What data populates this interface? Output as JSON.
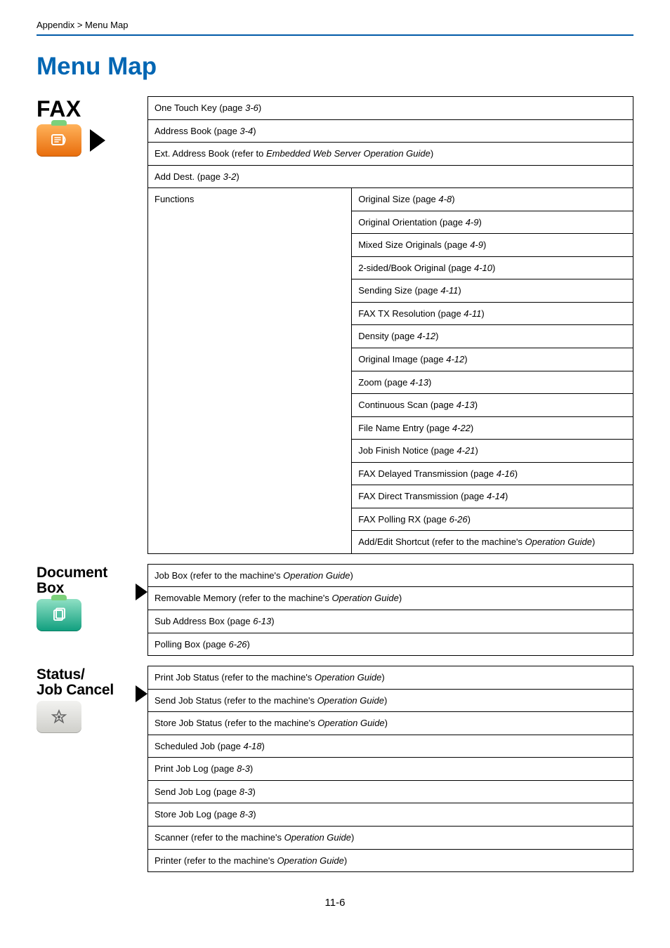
{
  "header": {
    "breadcrumb_left": "Appendix",
    "breadcrumb_sep": " > ",
    "breadcrumb_right": "Menu Map",
    "title": "Menu Map"
  },
  "sections": {
    "fax": {
      "label": "FAX",
      "rows": {
        "one_touch_key": {
          "text": "One Touch Key (page ",
          "page": "3-6",
          "close": ")"
        },
        "address_book": {
          "text": "Address Book (page ",
          "page": "3-4",
          "close": ")"
        },
        "ext_address_book": {
          "text": "Ext. Address Book (refer to ",
          "ref": "Embedded Web Server Operation Guide",
          "close": ")"
        },
        "add_dest": {
          "text": "Add Dest. (page ",
          "page": "3-2",
          "close": ")"
        },
        "functions_label": "Functions"
      },
      "functions": {
        "original_size": {
          "text": "Original Size (page ",
          "page": "4-8",
          "close": ")"
        },
        "original_orientation": {
          "text": "Original Orientation (page ",
          "page": "4-9",
          "close": ")"
        },
        "mixed_size_originals": {
          "text": "Mixed Size Originals (page ",
          "page": "4-9",
          "close": ")"
        },
        "two_sided_book": {
          "text": "2-sided/Book Original (page ",
          "page": "4-10",
          "close": ")"
        },
        "sending_size": {
          "text": "Sending Size (page ",
          "page": "4-11",
          "close": ")"
        },
        "fax_tx_resolution": {
          "text": "FAX TX Resolution (page ",
          "page": "4-11",
          "close": ")"
        },
        "density": {
          "text": "Density (page ",
          "page": "4-12",
          "close": ")"
        },
        "original_image": {
          "text": "Original Image (page ",
          "page": "4-12",
          "close": ")"
        },
        "zoom": {
          "text": "Zoom (page ",
          "page": "4-13",
          "close": ")"
        },
        "continuous_scan": {
          "text": "Continuous Scan (page ",
          "page": "4-13",
          "close": ")"
        },
        "file_name_entry": {
          "text": "File Name Entry (page ",
          "page": "4-22",
          "close": ")"
        },
        "job_finish_notice": {
          "text": "Job Finish Notice (page ",
          "page": "4-21",
          "close": ")"
        },
        "fax_delayed_tx": {
          "text": "FAX Delayed Transmission (page ",
          "page": "4-16",
          "close": ")"
        },
        "fax_direct_tx": {
          "text": "FAX Direct Transmission (page ",
          "page": "4-14",
          "close": ")"
        },
        "fax_polling_rx": {
          "text": "FAX Polling RX (page ",
          "page": "6-26",
          "close": ")"
        },
        "add_edit_shortcut": {
          "text": "Add/Edit Shortcut (refer to the machine's ",
          "ref": "Operation Guide",
          "close": ")"
        }
      }
    },
    "document_box": {
      "label_line1": "Document",
      "label_line2": "Box",
      "rows": {
        "job_box": {
          "text": "Job Box (refer to the machine's ",
          "ref": "Operation Guide",
          "close": ")"
        },
        "removable_memory": {
          "text": "Removable Memory (refer to the machine's ",
          "ref": "Operation Guide",
          "close": ")"
        },
        "sub_address_box": {
          "text": "Sub Address Box (page ",
          "page": "6-13",
          "close": ")"
        },
        "polling_box": {
          "text": "Polling Box (page ",
          "page": "6-26",
          "close": ")"
        }
      }
    },
    "status_job_cancel": {
      "label_line1": "Status/",
      "label_line2": "Job Cancel",
      "rows": {
        "print_job_status": {
          "text": "Print Job Status (refer to the machine's ",
          "ref": "Operation Guide",
          "close": ")"
        },
        "send_job_status": {
          "text": "Send Job Status (refer to the machine's ",
          "ref": "Operation Guide",
          "close": ")"
        },
        "store_job_status": {
          "text": "Store Job Status (refer to the machine's ",
          "ref": "Operation Guide",
          "close": ")"
        },
        "scheduled_job": {
          "text": "Scheduled Job (page ",
          "page": "4-18",
          "close": ")"
        },
        "print_job_log": {
          "text": "Print Job Log (page ",
          "page": "8-3",
          "close": ")"
        },
        "send_job_log": {
          "text": "Send Job Log (page ",
          "page": "8-3",
          "close": ")"
        },
        "store_job_log": {
          "text": "Store Job Log (page ",
          "page": "8-3",
          "close": ")"
        },
        "scanner": {
          "text": "Scanner (refer to the machine's ",
          "ref": "Operation Guide",
          "close": ")"
        },
        "printer": {
          "text": "Printer (refer to the machine's ",
          "ref": "Operation Guide",
          "close": ")"
        }
      }
    }
  },
  "page_number": "11-6"
}
